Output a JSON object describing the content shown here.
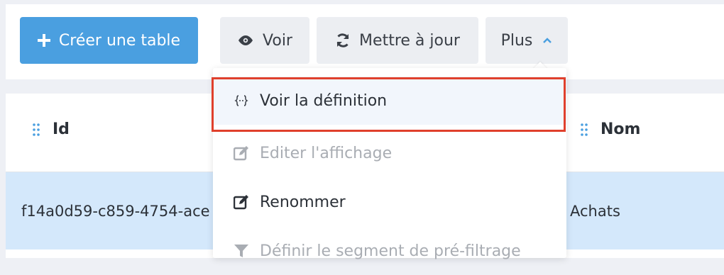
{
  "toolbar": {
    "create_label": "Créer une table",
    "view_label": "Voir",
    "update_label": "Mettre à jour",
    "more_label": "Plus"
  },
  "table": {
    "columns": [
      "Id",
      "Nom"
    ],
    "rows": [
      {
        "id": "f14a0d59-c859-4754-ace",
        "nom": "Achats"
      }
    ]
  },
  "dropdown": {
    "items": [
      {
        "label": "Voir la définition",
        "icon": "code-braces-icon",
        "enabled": true
      },
      {
        "label": "Editer l'affichage",
        "icon": "edit-icon",
        "enabled": false
      },
      {
        "label": "Renommer",
        "icon": "edit-icon",
        "enabled": true
      },
      {
        "label": "Définir le segment de pré-filtrage",
        "icon": "filter-icon",
        "enabled": false
      }
    ]
  },
  "colors": {
    "primary": "#4a9fe0",
    "highlight_border": "#e0402c",
    "row_selected": "#d4e8fb",
    "disabled_text": "#a9adb3"
  }
}
